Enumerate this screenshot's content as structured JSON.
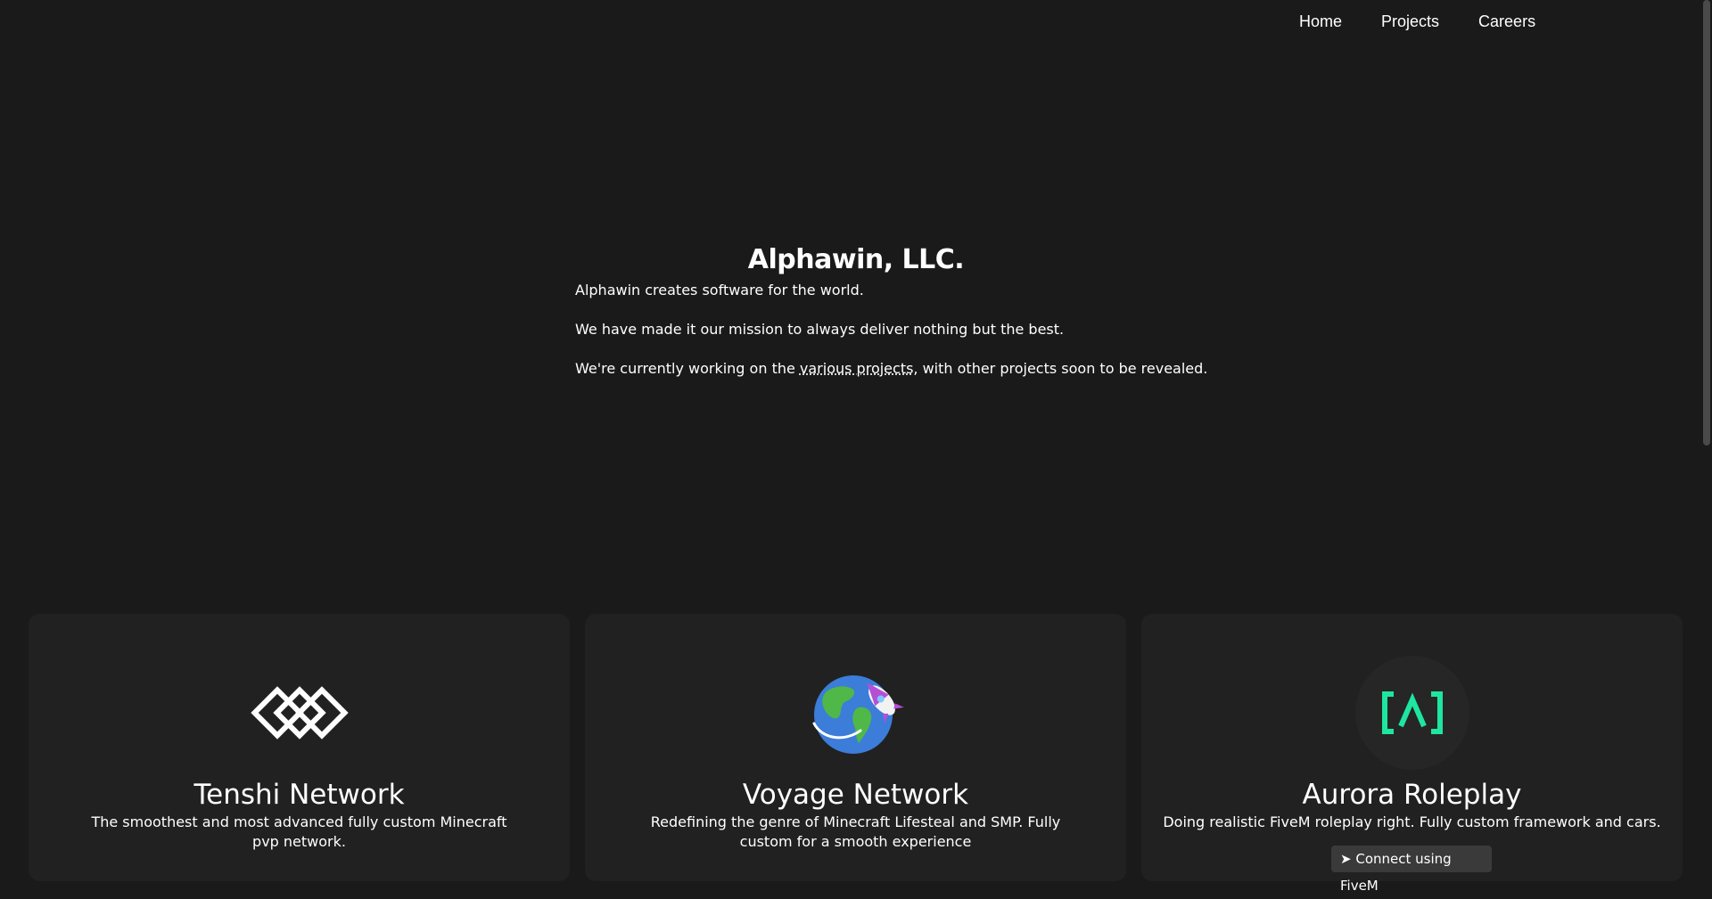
{
  "nav": {
    "items": [
      {
        "label": "Home"
      },
      {
        "label": "Projects"
      },
      {
        "label": "Careers"
      }
    ]
  },
  "hero": {
    "title": "Alphawin, LLC.",
    "line1": "Alphawin creates software for the world.",
    "line2": "We have made it our mission to always deliver nothing but the best.",
    "line3_before": "We're currently working on the ",
    "line3_link": "various projects",
    "line3_after": ", with other projects soon to be revealed."
  },
  "projects": [
    {
      "name": "Tenshi Network",
      "description": "The smoothest and most advanced fully custom Minecraft pvp network.",
      "logo_icon": "diamond-chain-icon"
    },
    {
      "name": "Voyage Network",
      "description": "Redefining the genre of Minecraft Lifesteal and SMP. Fully custom for a smooth experience",
      "logo_icon": "globe-rocket-icon"
    },
    {
      "name": "Aurora Roleplay",
      "description": "Doing realistic FiveM roleplay right. Fully custom framework and cars.",
      "logo_icon": "bracket-caret-icon",
      "button_label": "Connect using FiveM",
      "accent": "#1ee6a0"
    }
  ],
  "colors": {
    "background": "#1a1a1a",
    "card": "#212121"
  }
}
